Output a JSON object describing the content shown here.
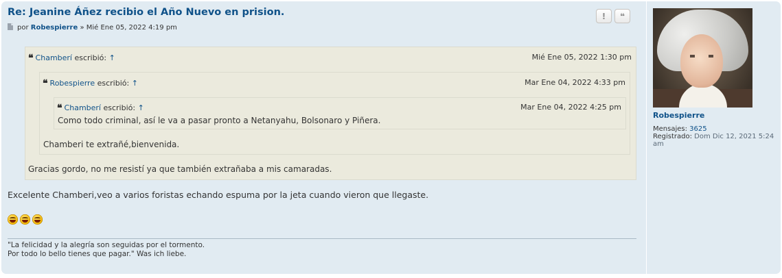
{
  "post": {
    "title": "Re: Jeanine Áñez recibio el Año Nuevo en prision.",
    "by": "por",
    "author": "Robespierre",
    "sep": "»",
    "date": "Mié Ene 05, 2022 4:19 pm",
    "buttons": {
      "report": "!",
      "quote": "❝"
    }
  },
  "quotes": {
    "q1": {
      "author": "Chamberí",
      "verb": "escribió:",
      "arrow": "↑",
      "date": "Mié Ene 05, 2022 1:30 pm",
      "text": "Gracias gordo, no me resistí ya que también extrañaba a mis camaradas."
    },
    "q2": {
      "author": "Robespierre",
      "verb": "escribió:",
      "arrow": "↑",
      "date": "Mar Ene 04, 2022 4:33 pm",
      "text": "Chamberi te extrañé,bienvenida."
    },
    "q3": {
      "author": "Chamberí",
      "verb": "escribió:",
      "arrow": "↑",
      "date": "Mar Ene 04, 2022 4:25 pm",
      "text": "Como todo criminal, así le va a pasar pronto a Netanyahu, Bolsonaro y Piñera."
    }
  },
  "body_text": "Excelente Chamberi,veo a varios foristas echando espuma por la jeta cuando vieron que llegaste.",
  "smilies": [
    "laughing-smiley",
    "laughing-smiley",
    "laughing-smiley"
  ],
  "signature": {
    "line1": "\"La felicidad y la alegría son seguidas por el tormento.",
    "line2": "Por todo lo bello tienes que pagar.\" Was ich liebe."
  },
  "profile": {
    "username": "Robespierre",
    "posts_label": "Mensajes:",
    "posts_value": "3625",
    "joined_label": "Registrado:",
    "joined_value": "Dom Dic 12, 2021 5:24",
    "joined_value_cont": "am"
  },
  "colors": {
    "link": "#105289",
    "post_bg": "#e1ebf2",
    "quote_bg": "#ebeadd"
  }
}
